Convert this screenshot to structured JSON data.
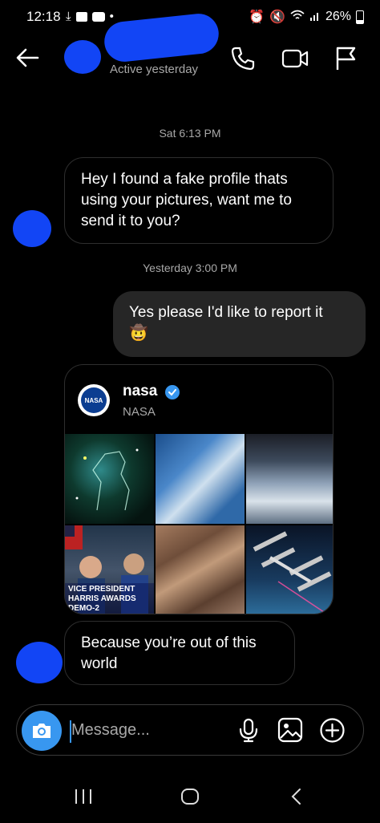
{
  "status_bar": {
    "time": "12:18",
    "battery": "26%"
  },
  "header": {
    "subtitle": "Active yesterday"
  },
  "timestamps": [
    "Sat 6:13 PM",
    "Yesterday 3:00 PM"
  ],
  "messages": [
    {
      "direction": "incoming",
      "text": "Hey I found a fake profile thats using your pictures, want me to send it to you?"
    },
    {
      "direction": "outgoing",
      "text": "Yes please I'd like to report it",
      "emoji": "🤠"
    },
    {
      "direction": "incoming",
      "text": "Because you’re out of this world"
    }
  ],
  "shared_post": {
    "username": "nasa",
    "display_name": "NASA",
    "verified": true,
    "logo_text": "NASA",
    "tile_caption": "VICE PRESIDENT HARRIS AWARDS DEMO-2"
  },
  "composer": {
    "placeholder": "Message..."
  },
  "colors": {
    "accent": "#3897f0",
    "verified": "#3897f0",
    "redaction": "#1245f5",
    "bubble_out": "#262626"
  }
}
